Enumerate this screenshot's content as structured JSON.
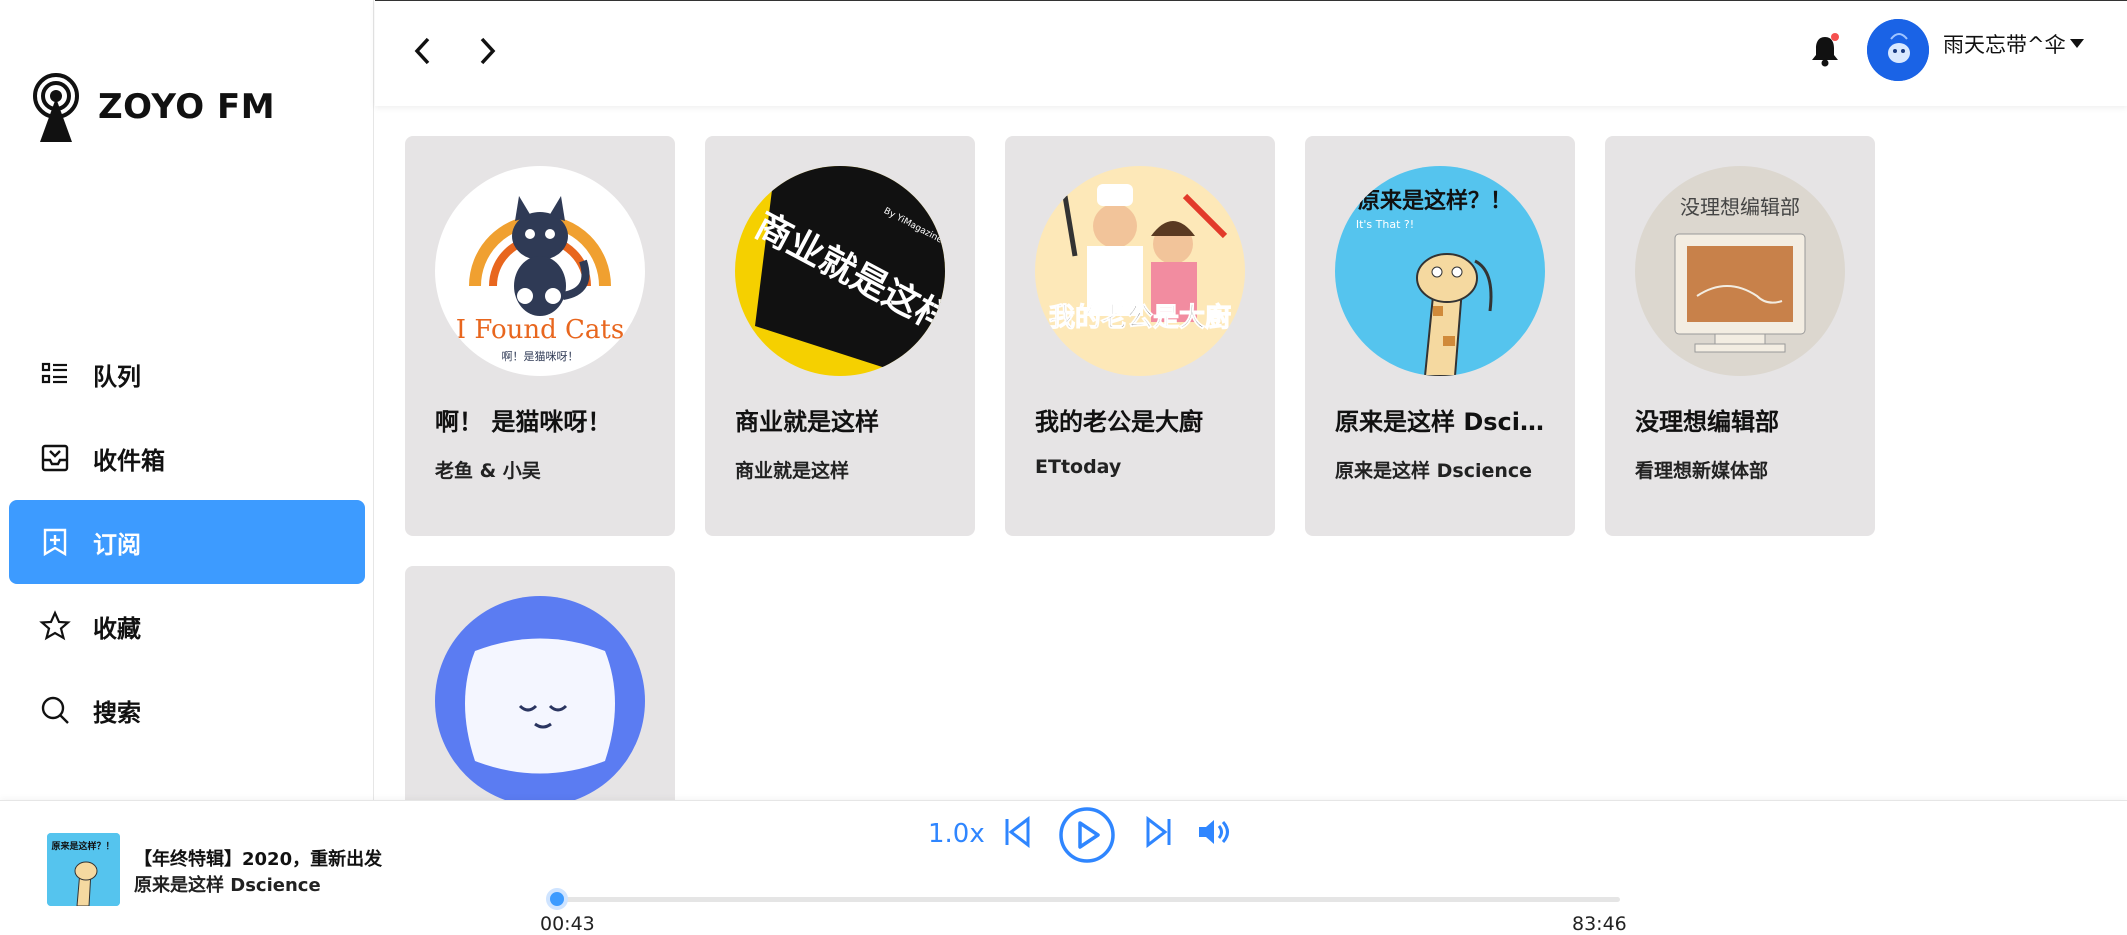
{
  "app": {
    "title": "ZOYO FM"
  },
  "sidebar": {
    "items": [
      {
        "label": "队列",
        "icon": "queue-list-icon",
        "active": false
      },
      {
        "label": "收件箱",
        "icon": "inbox-icon",
        "active": false
      },
      {
        "label": "订阅",
        "icon": "subscribe-icon",
        "active": true
      },
      {
        "label": "收藏",
        "icon": "star-icon",
        "active": false
      },
      {
        "label": "搜索",
        "icon": "search-icon",
        "active": false
      }
    ]
  },
  "header": {
    "back_icon": "chevron-left-icon",
    "forward_icon": "chevron-right-icon",
    "notification_icon": "bell-icon",
    "username": "雨天忘带^伞",
    "dropdown_icon": "caret-down-icon"
  },
  "podcasts": [
    {
      "title": "啊！ 是猫咪呀！",
      "author": "老鱼 & 小吴",
      "cover_text": "I Found Cats",
      "cover_subtext": "啊！是猫咪呀！"
    },
    {
      "title": "商业就是这样",
      "author": "商业就是这样",
      "cover_text": "商业就是这样",
      "cover_subtext": "By YiMagazine"
    },
    {
      "title": "我的老公是大廚",
      "author": "ETtoday",
      "cover_text": "我的老公是大廚"
    },
    {
      "title": "原来是这样 Dscience",
      "author": "原来是这样 Dscience",
      "cover_text": "原来是这样？！",
      "cover_subtext": "It's That ?!"
    },
    {
      "title": "没理想编辑部",
      "author": "看理想新媒体部",
      "cover_text": "没理想编辑部"
    },
    {
      "title": "",
      "author": ""
    }
  ],
  "player": {
    "title": "【年终特辑】2020，重新出发",
    "artist": "原来是这样 Dscience",
    "cover_text": "原来是这样？！",
    "speed": "1.0x",
    "current_time": "00:43",
    "total_time": "83:46",
    "progress": 0.0086,
    "colors": {
      "accent": "#3d9bff",
      "control": "#2f86ff"
    }
  }
}
